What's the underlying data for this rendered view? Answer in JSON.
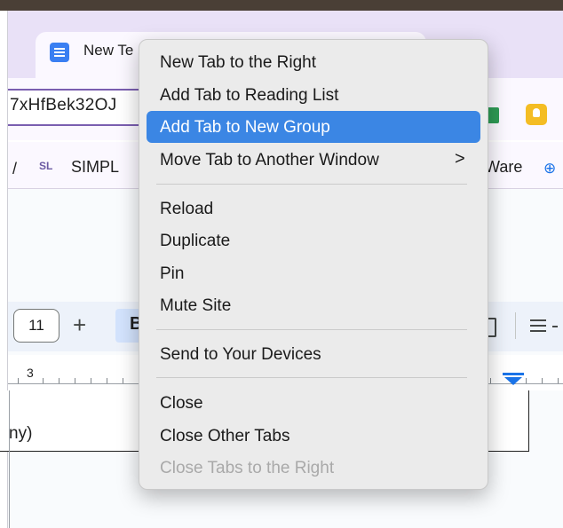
{
  "browser": {
    "tab": {
      "title": "New Te",
      "icon": "docs-icon"
    },
    "omnibox": {
      "text": "7xHfBek32OJ"
    },
    "bookmarks": {
      "left_fragment": "/",
      "simpl_icon": "SL",
      "simpl_label": "SIMPL",
      "ware_label": "Ware",
      "right_icon": "⊕"
    }
  },
  "doc": {
    "font_size": "11",
    "plus": "+",
    "bold_fragment": "B",
    "ruler_number": "3",
    "cell_text": "ny)"
  },
  "context_menu": {
    "items": [
      {
        "label": "New Tab to the Right"
      },
      {
        "label": "Add Tab to Reading List"
      },
      {
        "label": "Add Tab to New Group",
        "highlighted": true
      },
      {
        "label": "Move Tab to Another Window",
        "submenu": true
      },
      {
        "label": "Reload"
      },
      {
        "label": "Duplicate"
      },
      {
        "label": "Pin"
      },
      {
        "label": "Mute Site"
      },
      {
        "label": "Send to Your Devices"
      },
      {
        "label": "Close"
      },
      {
        "label": "Close Other Tabs"
      },
      {
        "label": "Close Tabs to the Right",
        "disabled": true
      }
    ],
    "submenu_chevron": ">",
    "highlight_color": "#3b86e4"
  }
}
